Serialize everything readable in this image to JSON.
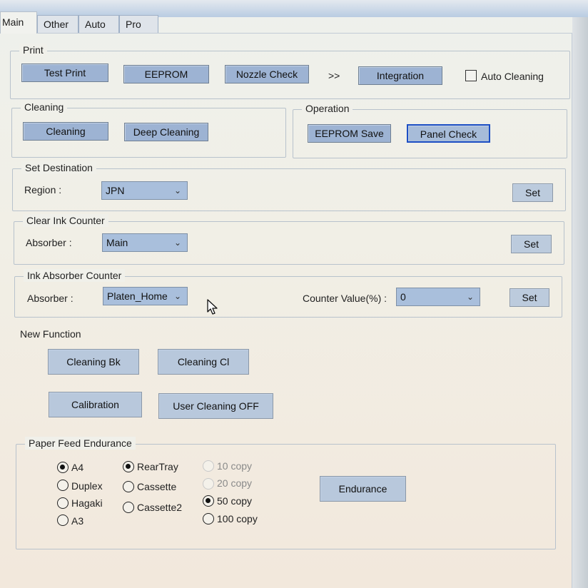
{
  "tabs": [
    {
      "label": "Main",
      "active": true
    },
    {
      "label": "Other",
      "active": false
    },
    {
      "label": "Auto",
      "active": false
    },
    {
      "label": "Pro",
      "active": false
    }
  ],
  "print": {
    "title": "Print",
    "test_print": "Test Print",
    "eeprom": "EEPROM",
    "nozzle_check": "Nozzle Check",
    "arrow": ">>",
    "integration": "Integration",
    "auto_cleaning_label": "Auto Cleaning",
    "auto_cleaning_checked": false
  },
  "cleaning": {
    "title": "Cleaning",
    "cleaning": "Cleaning",
    "deep_cleaning": "Deep Cleaning"
  },
  "operation": {
    "title": "Operation",
    "eeprom_save": "EEPROM Save",
    "panel_check": "Panel Check"
  },
  "set_destination": {
    "title": "Set Destination",
    "region_label": "Region :",
    "region_value": "JPN",
    "set": "Set"
  },
  "clear_ink_counter": {
    "title": "Clear Ink Counter",
    "absorber_label": "Absorber :",
    "absorber_value": "Main",
    "set": "Set"
  },
  "ink_absorber_counter": {
    "title": "Ink Absorber Counter",
    "absorber_label": "Absorber :",
    "absorber_value": "Platen_Home",
    "counter_label": "Counter Value(%) :",
    "counter_value": "0",
    "set": "Set"
  },
  "new_function": {
    "title": "New Function",
    "cleaning_bk": "Cleaning Bk",
    "cleaning_cl": "Cleaning Cl",
    "calibration": "Calibration",
    "user_cleaning_off": "User Cleaning OFF"
  },
  "paper_feed": {
    "title": "Paper Feed Endurance",
    "paper": [
      {
        "label": "A4",
        "checked": true
      },
      {
        "label": "Duplex",
        "checked": false
      },
      {
        "label": "Hagaki",
        "checked": false
      },
      {
        "label": "A3",
        "checked": false
      }
    ],
    "tray": [
      {
        "label": "RearTray",
        "checked": true
      },
      {
        "label": "Cassette",
        "checked": false
      },
      {
        "label": "Cassette2",
        "checked": false
      }
    ],
    "copies": [
      {
        "label": "10 copy",
        "checked": false,
        "disabled": true
      },
      {
        "label": "20 copy",
        "checked": false,
        "disabled": true
      },
      {
        "label": "50 copy",
        "checked": true,
        "disabled": false
      },
      {
        "label": "100 copy",
        "checked": false,
        "disabled": false
      }
    ],
    "endurance": "Endurance"
  }
}
